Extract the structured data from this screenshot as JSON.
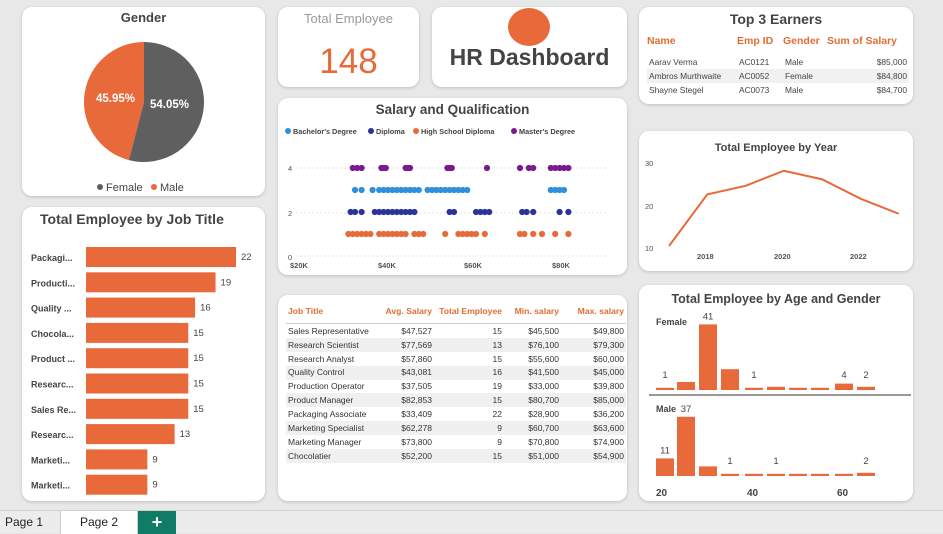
{
  "gender": {
    "title": "Gender",
    "female_pct": "45.95%",
    "male_pct": "54.05%",
    "female_value": 45.95,
    "male_value": 54.05,
    "legend": [
      {
        "label": "Female",
        "color": "#5f5f5f"
      },
      {
        "label": "Male",
        "color": "#e8693a"
      }
    ]
  },
  "total_employee": {
    "title": "Total Employee",
    "value": "148"
  },
  "hr": {
    "title": "HR Dashboard"
  },
  "top_earners": {
    "title": "Top 3 Earners",
    "headers": [
      "Name",
      "Emp ID",
      "Gender",
      "Sum of Salary"
    ],
    "rows": [
      [
        "Aarav Verma",
        "AC0121",
        "Male",
        "$85,000"
      ],
      [
        "Ambros Murthwaite",
        "AC0052",
        "Female",
        "$84,800"
      ],
      [
        "Shayne Stegel",
        "AC0073",
        "Male",
        "$84,700"
      ]
    ]
  },
  "salary_qual": {
    "title": "Salary and Qualification",
    "legend": [
      {
        "label": "Bachelor's Degree",
        "color": "#2e8fdc"
      },
      {
        "label": "Diploma",
        "color": "#2a3597"
      },
      {
        "label": "High School Diploma",
        "color": "#e8693a"
      },
      {
        "label": "Master's Degree",
        "color": "#7b1a8f"
      }
    ],
    "y_ticks": [
      "4",
      "2",
      "0"
    ],
    "x_ticks": [
      "$20K",
      "$40K",
      "$60K",
      "$80K"
    ]
  },
  "emp_by_year": {
    "title": "Total Employee by Year",
    "y_ticks": [
      "30",
      "20",
      "10"
    ],
    "x_ticks": [
      "2018",
      "2020",
      "2022"
    ]
  },
  "job_bars": {
    "title": "Total Employee by Job Title",
    "items": [
      {
        "label": "Packagi...",
        "value": "22"
      },
      {
        "label": "Producti...",
        "value": "19"
      },
      {
        "label": "Quality ...",
        "value": "16"
      },
      {
        "label": "Chocola...",
        "value": "15"
      },
      {
        "label": "Product ...",
        "value": "15"
      },
      {
        "label": "Researc...",
        "value": "15"
      },
      {
        "label": "Sales Re...",
        "value": "15"
      },
      {
        "label": "Researc...",
        "value": "13"
      },
      {
        "label": "Marketi...",
        "value": "9"
      },
      {
        "label": "Marketi...",
        "value": "9"
      }
    ]
  },
  "job_table": {
    "headers": [
      "Job Title",
      "Avg. Salary",
      "Total Employee",
      "Min. salary",
      "Max. salary"
    ],
    "rows": [
      [
        "Sales Representative",
        "$47,527",
        "15",
        "$45,500",
        "$49,800"
      ],
      [
        "Research Scientist",
        "$77,569",
        "13",
        "$76,100",
        "$79,300"
      ],
      [
        "Research Analyst",
        "$57,860",
        "15",
        "$55,600",
        "$60,000"
      ],
      [
        "Quality Control",
        "$43,081",
        "16",
        "$41,500",
        "$45,000"
      ],
      [
        "Production Operator",
        "$37,505",
        "19",
        "$33,000",
        "$39,800"
      ],
      [
        "Product Manager",
        "$82,853",
        "15",
        "$80,700",
        "$85,000"
      ],
      [
        "Packaging Associate",
        "$33,409",
        "22",
        "$28,900",
        "$36,200"
      ],
      [
        "Marketing Specialist",
        "$62,278",
        "9",
        "$60,700",
        "$63,600"
      ],
      [
        "Marketing Manager",
        "$73,800",
        "9",
        "$70,800",
        "$74,900"
      ],
      [
        "Chocolatier",
        "$52,200",
        "15",
        "$51,000",
        "$54,900"
      ]
    ]
  },
  "age_gender": {
    "title": "Total Employee by Age and Gender",
    "female_label": "Female",
    "male_label": "Male",
    "female_labels": [
      "1",
      "41",
      "1",
      "4",
      "2"
    ],
    "male_labels": [
      "11",
      "37",
      "1",
      "1",
      "2"
    ],
    "x_ticks": [
      "20",
      "40",
      "60"
    ]
  },
  "tabs": {
    "page1": "Page 1",
    "page2": "Page 2",
    "add": "+"
  },
  "chart_data": [
    {
      "type": "pie",
      "title": "Gender",
      "categories": [
        "Female",
        "Male"
      ],
      "values": [
        45.95,
        54.05
      ]
    },
    {
      "type": "bar",
      "title": "Total Employee by Job Title",
      "categories": [
        "Packagi...",
        "Producti...",
        "Quality ...",
        "Chocola...",
        "Product ...",
        "Researc...",
        "Sales Re...",
        "Researc...",
        "Marketi...",
        "Marketi..."
      ],
      "values": [
        22,
        19,
        16,
        15,
        15,
        15,
        15,
        13,
        9,
        9
      ]
    },
    {
      "type": "line",
      "title": "Total Employee by Year",
      "x": [
        2017,
        2018,
        2019,
        2020,
        2021,
        2022,
        2023
      ],
      "values": [
        10,
        22,
        24,
        27.5,
        25.5,
        21,
        17.5
      ],
      "ylim": [
        10,
        30
      ]
    },
    {
      "type": "scatter",
      "title": "Salary and Qualification",
      "xlim": [
        20000,
        95000
      ],
      "ylim": [
        0,
        5
      ],
      "series": [
        {
          "name": "Master's Degree",
          "y": 4,
          "x": [
            32000,
            33000,
            34000,
            38500,
            39000,
            39500,
            44000,
            44500,
            45000,
            53500,
            54000,
            54500,
            62500,
            70000,
            72000,
            73000,
            77000,
            78000,
            79000,
            80000,
            81000
          ]
        },
        {
          "name": "Bachelor's Degree",
          "y": 3,
          "x": [
            32500,
            34000,
            36500,
            38000,
            39000,
            40000,
            41000,
            42000,
            43000,
            44000,
            45000,
            46000,
            47000,
            49000,
            50000,
            51000,
            52000,
            53000,
            54000,
            55000,
            56000,
            57000,
            58000,
            77000,
            78000,
            79000,
            80000
          ]
        },
        {
          "name": "Diploma",
          "y": 2,
          "x": [
            31500,
            32500,
            34000,
            37000,
            38000,
            39000,
            40000,
            41000,
            42000,
            43000,
            44000,
            45000,
            46000,
            54000,
            55000,
            60000,
            61000,
            62000,
            63000,
            70500,
            71500,
            73000,
            79000,
            81000
          ]
        },
        {
          "name": "High School Diploma",
          "y": 1,
          "x": [
            31000,
            32000,
            33000,
            34000,
            35000,
            36000,
            38000,
            39000,
            40000,
            41000,
            42000,
            43000,
            44000,
            46000,
            47000,
            48000,
            53000,
            56000,
            57000,
            58000,
            59000,
            60000,
            62000,
            70000,
            71000,
            73000,
            75000,
            78000,
            81000
          ]
        }
      ]
    },
    {
      "type": "bar",
      "title": "Total Employee by Age and Gender",
      "series": [
        {
          "name": "Female",
          "x": [
            20,
            25,
            30,
            35,
            40,
            45,
            50,
            55,
            60,
            65
          ],
          "values": [
            1,
            5,
            41,
            13,
            1,
            2,
            1,
            1,
            4,
            2
          ]
        },
        {
          "name": "Male",
          "x": [
            20,
            25,
            30,
            35,
            40,
            45,
            50,
            55,
            60,
            65
          ],
          "values": [
            11,
            37,
            6,
            1,
            1,
            1,
            1,
            1,
            1,
            2
          ]
        }
      ]
    }
  ]
}
